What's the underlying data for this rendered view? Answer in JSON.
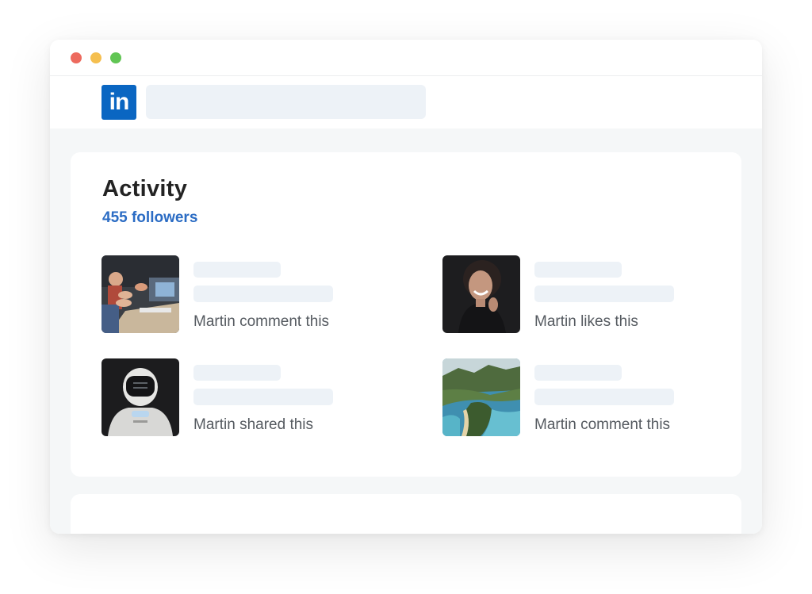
{
  "window": {
    "controls": [
      "close",
      "minimize",
      "maximize"
    ],
    "colors": {
      "close": "#ed6a5e",
      "minimize": "#f5bf4f",
      "maximize": "#61c554"
    }
  },
  "navbar": {
    "logo_text": "in",
    "logo_color": "#0a66c2"
  },
  "activity": {
    "title": "Activity",
    "followers": "455 followers",
    "accent_color": "#2b6cc4",
    "items": [
      {
        "text": "Martin comment this",
        "image": "office-meeting-photo"
      },
      {
        "text": "Martin likes this",
        "image": "smiling-woman-photo"
      },
      {
        "text": "Martin shared this",
        "image": "robot-photo"
      },
      {
        "text": "Martin comment this",
        "image": "island-aerial-photo"
      }
    ]
  }
}
